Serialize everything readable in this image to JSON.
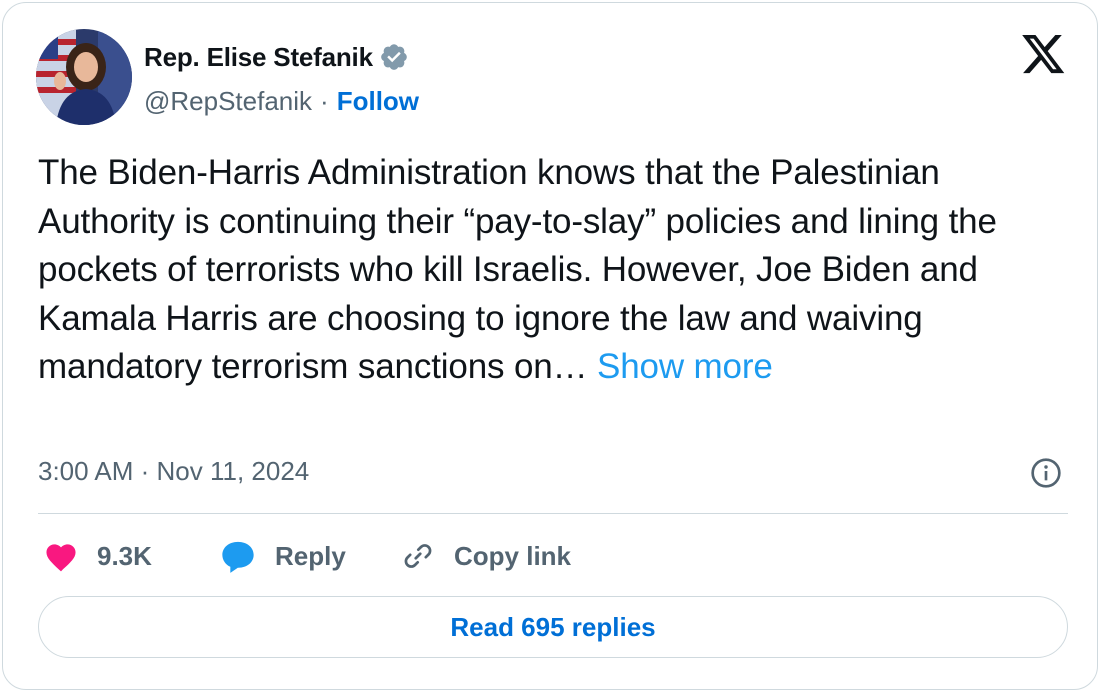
{
  "author": {
    "name": "Rep. Elise Stefanik",
    "handle": "@RepStefanik",
    "separator": "·",
    "follow_label": "Follow"
  },
  "tweet": {
    "text": "The Biden-Harris Administration knows that the Palestinian Authority is continuing their “pay-to-slay” policies and lining the pockets of terrorists who kill Israelis. However, Joe Biden and Kamala Harris are choosing to ignore the law and waiving mandatory terrorism sanctions on… ",
    "show_more_label": "Show more",
    "timestamp": "3:00 AM · Nov 11, 2024"
  },
  "actions": {
    "like_count": "9.3K",
    "reply_label": "Reply",
    "copy_link_label": "Copy link",
    "read_replies_label": "Read 695 replies"
  },
  "icons": {
    "verified": "verified-badge-icon",
    "brand": "x-logo-icon",
    "info": "info-icon",
    "like": "heart-icon",
    "reply": "speech-bubble-icon",
    "copy_link": "link-icon"
  },
  "colors": {
    "text": "#0f1419",
    "secondary": "#536471",
    "link": "#006fd6",
    "show_more": "#1d9bf0",
    "like": "#f91880",
    "reply": "#1d9bf0",
    "border": "#cfd9de"
  }
}
